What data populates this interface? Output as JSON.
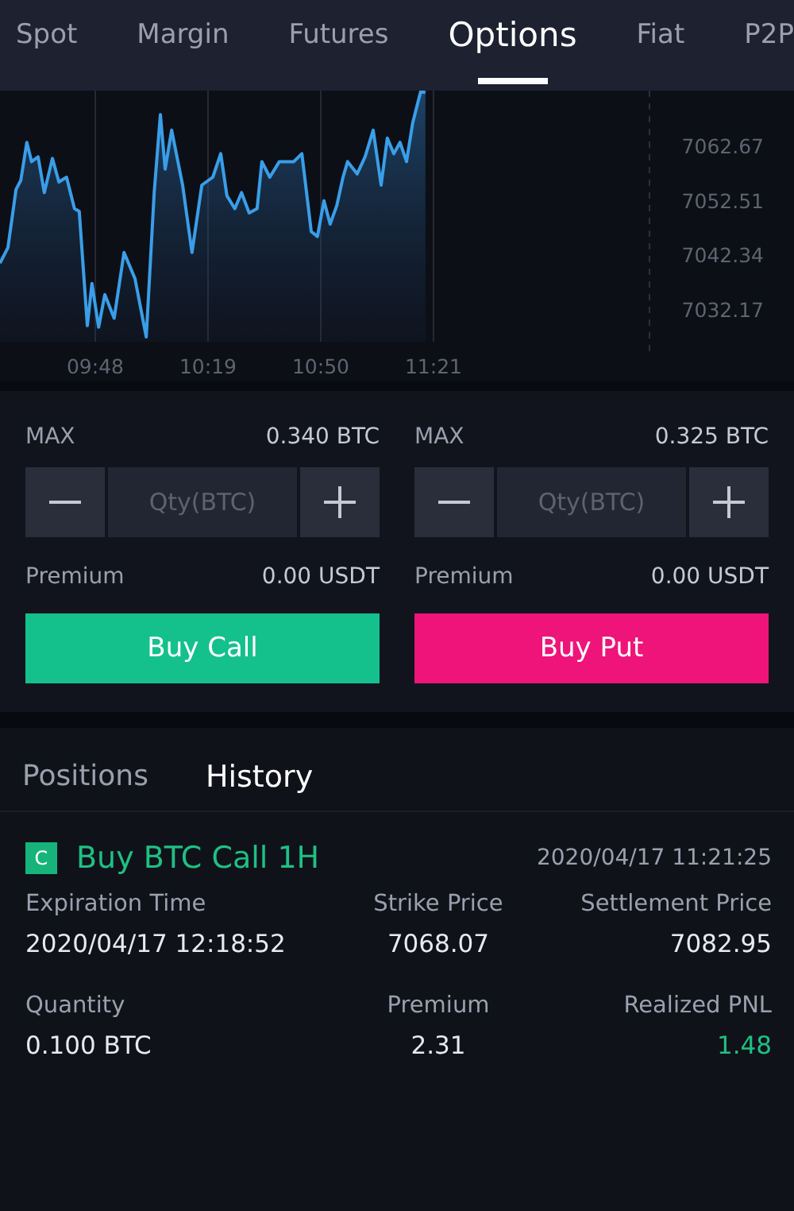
{
  "tabs": [
    {
      "label": "Spot",
      "selected": false
    },
    {
      "label": "Margin",
      "selected": false
    },
    {
      "label": "Futures",
      "selected": false
    },
    {
      "label": "Options",
      "selected": true
    },
    {
      "label": "Fiat",
      "selected": false
    },
    {
      "label": "P2P",
      "selected": false
    }
  ],
  "chart": {
    "chart_data": {
      "type": "area",
      "grid": true,
      "xlim": [
        561.8,
        740.4
      ],
      "ylim": [
        7026,
        7073
      ],
      "xticks": [
        {
          "value": 588,
          "label": "09:48"
        },
        {
          "value": 619,
          "label": "10:19"
        },
        {
          "value": 650,
          "label": "10:50"
        },
        {
          "value": 681,
          "label": "11:21"
        }
      ],
      "yticks": [
        7062.67,
        7052.51,
        7042.34,
        7032.17
      ],
      "x": [
        561.8,
        564.0,
        566.2,
        567.5,
        569.2,
        570.5,
        572.3,
        574.0,
        576.2,
        578.0,
        580.1,
        582.3,
        583.6,
        584.9,
        585.8,
        587.1,
        588.9,
        590.6,
        593.2,
        595.9,
        598.9,
        602.0,
        604.2,
        605.9,
        607.2,
        609.0,
        612.0,
        614.6,
        617.3,
        620.3,
        622.5,
        624.2,
        626.4,
        628.2,
        630.3,
        632.5,
        633.8,
        636.0,
        638.6,
        642.6,
        644.8,
        647.4,
        649.1,
        650.9,
        652.6,
        654.4,
        656.1,
        657.4,
        660.0,
        662.2,
        664.4,
        666.6,
        668.3,
        670.1,
        671.8,
        673.6,
        675.3,
        677.5,
        678.8
      ],
      "series": [
        {
          "color": "#3a9ee8",
          "values": [
            7040.7,
            7043.6,
            7054.5,
            7056.2,
            7063.3,
            7059.7,
            7060.6,
            7053.9,
            7060.3,
            7055.9,
            7056.8,
            7050.9,
            7050.4,
            7037.8,
            7029.0,
            7036.9,
            7028.7,
            7034.8,
            7030.4,
            7042.7,
            7037.8,
            7026.9,
            7053.9,
            7068.5,
            7058.3,
            7065.6,
            7055.3,
            7042.7,
            7055.3,
            7056.8,
            7061.2,
            7053.3,
            7050.9,
            7053.9,
            7050.1,
            7050.9,
            7059.7,
            7056.8,
            7059.7,
            7059.7,
            7061.2,
            7046.6,
            7045.7,
            7052.4,
            7048.0,
            7051.5,
            7056.8,
            7059.7,
            7057.4,
            7060.6,
            7065.6,
            7055.3,
            7064.1,
            7061.2,
            7063.3,
            7059.7,
            7067.0,
            7072.9,
            7072.6
          ]
        }
      ]
    }
  },
  "order_panels": [
    {
      "max_label": "MAX",
      "max_value": "0.340 BTC",
      "qty_placeholder": "Qty(BTC)",
      "premium_label": "Premium",
      "premium_value": "0.00 USDT",
      "button": {
        "label": "Buy Call",
        "kind": "call"
      }
    },
    {
      "max_label": "MAX",
      "max_value": "0.325 BTC",
      "qty_placeholder": "Qty(BTC)",
      "premium_label": "Premium",
      "premium_value": "0.00 USDT",
      "button": {
        "label": "Buy Put",
        "kind": "put"
      }
    }
  ],
  "history_tabs": [
    {
      "label": "Positions",
      "selected": false
    },
    {
      "label": "History",
      "selected": true
    }
  ],
  "history": [
    {
      "badge": "C",
      "title": "Buy BTC Call 1H",
      "time": "2020/04/17 11:21:25",
      "fields": [
        {
          "label": "Expiration Time",
          "value": "2020/04/17 12:18:52",
          "kind": "plain"
        },
        {
          "label": "Strike Price",
          "value": "7068.07",
          "kind": "plain"
        },
        {
          "label": "Settlement Price",
          "value": "7082.95",
          "kind": "plain"
        },
        {
          "label": "Quantity",
          "value": "0.100 BTC",
          "kind": "plain"
        },
        {
          "label": "Premium",
          "value": "2.31",
          "kind": "plain"
        },
        {
          "label": "Realized PNL",
          "value": "1.48",
          "kind": "profit"
        }
      ]
    }
  ]
}
